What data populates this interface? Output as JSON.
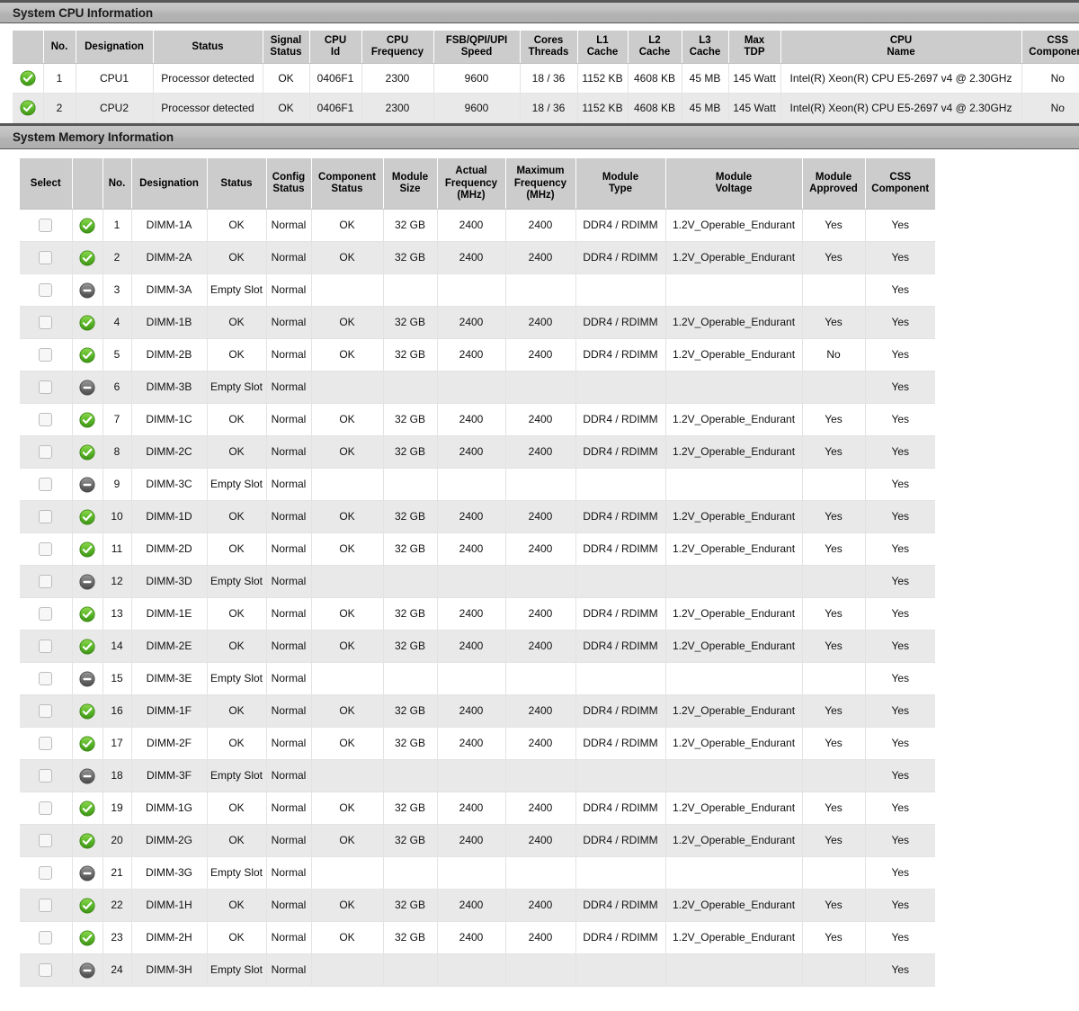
{
  "cpu_section": {
    "title": "System CPU Information",
    "columns": [
      {
        "key": "icon",
        "label": ""
      },
      {
        "key": "no",
        "label": "No."
      },
      {
        "key": "designation",
        "label": "Designation"
      },
      {
        "key": "status",
        "label": "Status"
      },
      {
        "key": "signal_status",
        "label": "Signal\nStatus"
      },
      {
        "key": "cpu_id",
        "label": "CPU\nId"
      },
      {
        "key": "cpu_frequency",
        "label": "CPU\nFrequency"
      },
      {
        "key": "fsb_qpi_upi_speed",
        "label": "FSB/QPI/UPI\nSpeed"
      },
      {
        "key": "cores_threads",
        "label": "Cores\nThreads"
      },
      {
        "key": "l1_cache",
        "label": "L1\nCache"
      },
      {
        "key": "l2_cache",
        "label": "L2\nCache"
      },
      {
        "key": "l3_cache",
        "label": "L3\nCache"
      },
      {
        "key": "max_tdp",
        "label": "Max\nTDP"
      },
      {
        "key": "cpu_name",
        "label": "CPU\nName"
      },
      {
        "key": "css_component",
        "label": "CSS\nComponent"
      }
    ],
    "rows": [
      {
        "icon": "status-ok-icon",
        "no": "1",
        "designation": "CPU1",
        "status": "Processor detected",
        "signal_status": "OK",
        "cpu_id": "0406F1",
        "cpu_frequency": "2300",
        "fsb_qpi_upi_speed": "9600",
        "cores_threads": "18 / 36",
        "l1_cache": "1152 KB",
        "l2_cache": "4608 KB",
        "l3_cache": "45 MB",
        "max_tdp": "145 Watt",
        "cpu_name": "Intel(R) Xeon(R) CPU E5-2697 v4 @ 2.30GHz",
        "css_component": "No"
      },
      {
        "icon": "status-ok-icon",
        "no": "2",
        "designation": "CPU2",
        "status": "Processor detected",
        "signal_status": "OK",
        "cpu_id": "0406F1",
        "cpu_frequency": "2300",
        "fsb_qpi_upi_speed": "9600",
        "cores_threads": "18 / 36",
        "l1_cache": "1152 KB",
        "l2_cache": "4608 KB",
        "l3_cache": "45 MB",
        "max_tdp": "145 Watt",
        "cpu_name": "Intel(R) Xeon(R) CPU E5-2697 v4 @ 2.30GHz",
        "css_component": "No"
      }
    ]
  },
  "memory_section": {
    "title": "System Memory Information",
    "columns": [
      {
        "key": "select",
        "label": "Select"
      },
      {
        "key": "icon",
        "label": ""
      },
      {
        "key": "no",
        "label": "No."
      },
      {
        "key": "designation",
        "label": "Designation"
      },
      {
        "key": "status",
        "label": "Status"
      },
      {
        "key": "config_status",
        "label": "Config\nStatus"
      },
      {
        "key": "component_status",
        "label": "Component\nStatus"
      },
      {
        "key": "module_size",
        "label": "Module\nSize"
      },
      {
        "key": "actual_frequency",
        "label": "Actual\nFrequency\n(MHz)"
      },
      {
        "key": "maximum_frequency",
        "label": "Maximum\nFrequency\n(MHz)"
      },
      {
        "key": "module_type",
        "label": "Module\nType"
      },
      {
        "key": "module_voltage",
        "label": "Module\nVoltage"
      },
      {
        "key": "module_approved",
        "label": "Module\nApproved"
      },
      {
        "key": "css_component",
        "label": "CSS\nComponent"
      }
    ],
    "rows": [
      {
        "icon": "status-ok-icon",
        "no": "1",
        "designation": "DIMM-1A",
        "status": "OK",
        "config_status": "Normal",
        "component_status": "OK",
        "module_size": "32 GB",
        "actual_frequency": "2400",
        "maximum_frequency": "2400",
        "module_type": "DDR4 / RDIMM",
        "module_voltage": "1.2V_Operable_Endurant",
        "module_approved": "Yes",
        "css_component": "Yes"
      },
      {
        "icon": "status-ok-icon",
        "no": "2",
        "designation": "DIMM-2A",
        "status": "OK",
        "config_status": "Normal",
        "component_status": "OK",
        "module_size": "32 GB",
        "actual_frequency": "2400",
        "maximum_frequency": "2400",
        "module_type": "DDR4 / RDIMM",
        "module_voltage": "1.2V_Operable_Endurant",
        "module_approved": "Yes",
        "css_component": "Yes"
      },
      {
        "icon": "status-empty-icon",
        "no": "3",
        "designation": "DIMM-3A",
        "status": "Empty Slot",
        "config_status": "Normal",
        "component_status": "",
        "module_size": "",
        "actual_frequency": "",
        "maximum_frequency": "",
        "module_type": "",
        "module_voltage": "",
        "module_approved": "",
        "css_component": "Yes"
      },
      {
        "icon": "status-ok-icon",
        "no": "4",
        "designation": "DIMM-1B",
        "status": "OK",
        "config_status": "Normal",
        "component_status": "OK",
        "module_size": "32 GB",
        "actual_frequency": "2400",
        "maximum_frequency": "2400",
        "module_type": "DDR4 / RDIMM",
        "module_voltage": "1.2V_Operable_Endurant",
        "module_approved": "Yes",
        "css_component": "Yes"
      },
      {
        "icon": "status-ok-icon",
        "no": "5",
        "designation": "DIMM-2B",
        "status": "OK",
        "config_status": "Normal",
        "component_status": "OK",
        "module_size": "32 GB",
        "actual_frequency": "2400",
        "maximum_frequency": "2400",
        "module_type": "DDR4 / RDIMM",
        "module_voltage": "1.2V_Operable_Endurant",
        "module_approved": "No",
        "css_component": "Yes"
      },
      {
        "icon": "status-empty-icon",
        "no": "6",
        "designation": "DIMM-3B",
        "status": "Empty Slot",
        "config_status": "Normal",
        "component_status": "",
        "module_size": "",
        "actual_frequency": "",
        "maximum_frequency": "",
        "module_type": "",
        "module_voltage": "",
        "module_approved": "",
        "css_component": "Yes"
      },
      {
        "icon": "status-ok-icon",
        "no": "7",
        "designation": "DIMM-1C",
        "status": "OK",
        "config_status": "Normal",
        "component_status": "OK",
        "module_size": "32 GB",
        "actual_frequency": "2400",
        "maximum_frequency": "2400",
        "module_type": "DDR4 / RDIMM",
        "module_voltage": "1.2V_Operable_Endurant",
        "module_approved": "Yes",
        "css_component": "Yes"
      },
      {
        "icon": "status-ok-icon",
        "no": "8",
        "designation": "DIMM-2C",
        "status": "OK",
        "config_status": "Normal",
        "component_status": "OK",
        "module_size": "32 GB",
        "actual_frequency": "2400",
        "maximum_frequency": "2400",
        "module_type": "DDR4 / RDIMM",
        "module_voltage": "1.2V_Operable_Endurant",
        "module_approved": "Yes",
        "css_component": "Yes"
      },
      {
        "icon": "status-empty-icon",
        "no": "9",
        "designation": "DIMM-3C",
        "status": "Empty Slot",
        "config_status": "Normal",
        "component_status": "",
        "module_size": "",
        "actual_frequency": "",
        "maximum_frequency": "",
        "module_type": "",
        "module_voltage": "",
        "module_approved": "",
        "css_component": "Yes"
      },
      {
        "icon": "status-ok-icon",
        "no": "10",
        "designation": "DIMM-1D",
        "status": "OK",
        "config_status": "Normal",
        "component_status": "OK",
        "module_size": "32 GB",
        "actual_frequency": "2400",
        "maximum_frequency": "2400",
        "module_type": "DDR4 / RDIMM",
        "module_voltage": "1.2V_Operable_Endurant",
        "module_approved": "Yes",
        "css_component": "Yes"
      },
      {
        "icon": "status-ok-icon",
        "no": "11",
        "designation": "DIMM-2D",
        "status": "OK",
        "config_status": "Normal",
        "component_status": "OK",
        "module_size": "32 GB",
        "actual_frequency": "2400",
        "maximum_frequency": "2400",
        "module_type": "DDR4 / RDIMM",
        "module_voltage": "1.2V_Operable_Endurant",
        "module_approved": "Yes",
        "css_component": "Yes"
      },
      {
        "icon": "status-empty-icon",
        "no": "12",
        "designation": "DIMM-3D",
        "status": "Empty Slot",
        "config_status": "Normal",
        "component_status": "",
        "module_size": "",
        "actual_frequency": "",
        "maximum_frequency": "",
        "module_type": "",
        "module_voltage": "",
        "module_approved": "",
        "css_component": "Yes"
      },
      {
        "icon": "status-ok-icon",
        "no": "13",
        "designation": "DIMM-1E",
        "status": "OK",
        "config_status": "Normal",
        "component_status": "OK",
        "module_size": "32 GB",
        "actual_frequency": "2400",
        "maximum_frequency": "2400",
        "module_type": "DDR4 / RDIMM",
        "module_voltage": "1.2V_Operable_Endurant",
        "module_approved": "Yes",
        "css_component": "Yes"
      },
      {
        "icon": "status-ok-icon",
        "no": "14",
        "designation": "DIMM-2E",
        "status": "OK",
        "config_status": "Normal",
        "component_status": "OK",
        "module_size": "32 GB",
        "actual_frequency": "2400",
        "maximum_frequency": "2400",
        "module_type": "DDR4 / RDIMM",
        "module_voltage": "1.2V_Operable_Endurant",
        "module_approved": "Yes",
        "css_component": "Yes"
      },
      {
        "icon": "status-empty-icon",
        "no": "15",
        "designation": "DIMM-3E",
        "status": "Empty Slot",
        "config_status": "Normal",
        "component_status": "",
        "module_size": "",
        "actual_frequency": "",
        "maximum_frequency": "",
        "module_type": "",
        "module_voltage": "",
        "module_approved": "",
        "css_component": "Yes"
      },
      {
        "icon": "status-ok-icon",
        "no": "16",
        "designation": "DIMM-1F",
        "status": "OK",
        "config_status": "Normal",
        "component_status": "OK",
        "module_size": "32 GB",
        "actual_frequency": "2400",
        "maximum_frequency": "2400",
        "module_type": "DDR4 / RDIMM",
        "module_voltage": "1.2V_Operable_Endurant",
        "module_approved": "Yes",
        "css_component": "Yes"
      },
      {
        "icon": "status-ok-icon",
        "no": "17",
        "designation": "DIMM-2F",
        "status": "OK",
        "config_status": "Normal",
        "component_status": "OK",
        "module_size": "32 GB",
        "actual_frequency": "2400",
        "maximum_frequency": "2400",
        "module_type": "DDR4 / RDIMM",
        "module_voltage": "1.2V_Operable_Endurant",
        "module_approved": "Yes",
        "css_component": "Yes"
      },
      {
        "icon": "status-empty-icon",
        "no": "18",
        "designation": "DIMM-3F",
        "status": "Empty Slot",
        "config_status": "Normal",
        "component_status": "",
        "module_size": "",
        "actual_frequency": "",
        "maximum_frequency": "",
        "module_type": "",
        "module_voltage": "",
        "module_approved": "",
        "css_component": "Yes"
      },
      {
        "icon": "status-ok-icon",
        "no": "19",
        "designation": "DIMM-1G",
        "status": "OK",
        "config_status": "Normal",
        "component_status": "OK",
        "module_size": "32 GB",
        "actual_frequency": "2400",
        "maximum_frequency": "2400",
        "module_type": "DDR4 / RDIMM",
        "module_voltage": "1.2V_Operable_Endurant",
        "module_approved": "Yes",
        "css_component": "Yes"
      },
      {
        "icon": "status-ok-icon",
        "no": "20",
        "designation": "DIMM-2G",
        "status": "OK",
        "config_status": "Normal",
        "component_status": "OK",
        "module_size": "32 GB",
        "actual_frequency": "2400",
        "maximum_frequency": "2400",
        "module_type": "DDR4 / RDIMM",
        "module_voltage": "1.2V_Operable_Endurant",
        "module_approved": "Yes",
        "css_component": "Yes"
      },
      {
        "icon": "status-empty-icon",
        "no": "21",
        "designation": "DIMM-3G",
        "status": "Empty Slot",
        "config_status": "Normal",
        "component_status": "",
        "module_size": "",
        "actual_frequency": "",
        "maximum_frequency": "",
        "module_type": "",
        "module_voltage": "",
        "module_approved": "",
        "css_component": "Yes"
      },
      {
        "icon": "status-ok-icon",
        "no": "22",
        "designation": "DIMM-1H",
        "status": "OK",
        "config_status": "Normal",
        "component_status": "OK",
        "module_size": "32 GB",
        "actual_frequency": "2400",
        "maximum_frequency": "2400",
        "module_type": "DDR4 / RDIMM",
        "module_voltage": "1.2V_Operable_Endurant",
        "module_approved": "Yes",
        "css_component": "Yes"
      },
      {
        "icon": "status-ok-icon",
        "no": "23",
        "designation": "DIMM-2H",
        "status": "OK",
        "config_status": "Normal",
        "component_status": "OK",
        "module_size": "32 GB",
        "actual_frequency": "2400",
        "maximum_frequency": "2400",
        "module_type": "DDR4 / RDIMM",
        "module_voltage": "1.2V_Operable_Endurant",
        "module_approved": "Yes",
        "css_component": "Yes"
      },
      {
        "icon": "status-empty-icon",
        "no": "24",
        "designation": "DIMM-3H",
        "status": "Empty Slot",
        "config_status": "Normal",
        "component_status": "",
        "module_size": "",
        "actual_frequency": "",
        "maximum_frequency": "",
        "module_type": "",
        "module_voltage": "",
        "module_approved": "",
        "css_component": "Yes"
      }
    ]
  },
  "colors": {
    "status_ok_green": "#5cb82b",
    "status_empty_gray": "#6e6e6e",
    "header_bar_gray": "#bdbdbd",
    "table_header_gray": "#cccccc",
    "row_stripe_gray": "#e9e9e9"
  }
}
